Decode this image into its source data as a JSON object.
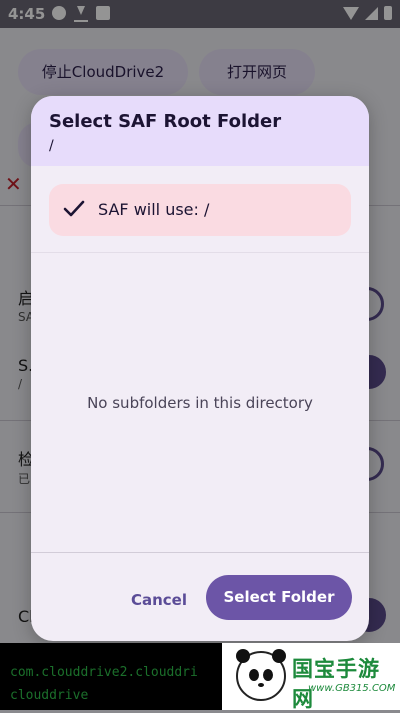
{
  "status_bar": {
    "time": "4:45"
  },
  "background": {
    "stop_button": "停止CloudDrive2",
    "open_web_button": "打开网页",
    "rows": [
      {
        "title": "启",
        "sub": "SA"
      },
      {
        "title": "S.",
        "sub": "/"
      },
      {
        "title": "检",
        "sub": "已"
      },
      {
        "title": "Cl",
        "sub": ""
      }
    ],
    "terminal_lines": [
      "com.clouddrive2.clouddri",
      "clouddrive"
    ]
  },
  "dialog": {
    "title": "Select SAF Root Folder",
    "path": "/",
    "saf_banner": "SAF will use: /",
    "empty_message": "No subfolders in this directory",
    "cancel_label": "Cancel",
    "select_label": "Select Folder"
  },
  "watermark": {
    "title": "国宝手游网",
    "url": "www.GB315.COM"
  },
  "colors": {
    "accent": "#6c55a7",
    "dialog_header": "#e7dcfb",
    "banner": "#fadbe2",
    "terminal_text": "#2fbf4a"
  }
}
